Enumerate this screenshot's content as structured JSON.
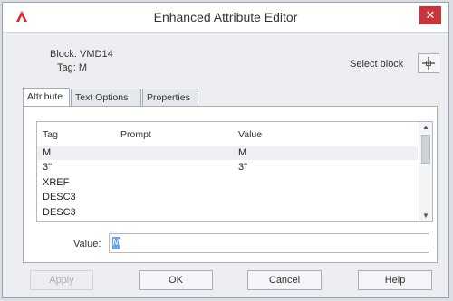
{
  "window": {
    "title": "Enhanced Attribute Editor",
    "close_glyph": "✕"
  },
  "block": {
    "block_line": "Block: VMD14",
    "tag_line": "Tag: M",
    "select_block_label": "Select block"
  },
  "tabs": [
    {
      "label": "Attribute",
      "active": true
    },
    {
      "label": "Text Options",
      "active": false
    },
    {
      "label": "Properties",
      "active": false
    }
  ],
  "table": {
    "headers": [
      "Tag",
      "Prompt",
      "Value"
    ],
    "rows": [
      {
        "tag": "M",
        "prompt": "",
        "value": "M",
        "selected": true
      },
      {
        "tag": "3\"",
        "prompt": "",
        "value": "3\"",
        "selected": false
      },
      {
        "tag": "XREF",
        "prompt": "",
        "value": "",
        "selected": false
      },
      {
        "tag": "DESC3",
        "prompt": "",
        "value": "",
        "selected": false
      },
      {
        "tag": "DESC3",
        "prompt": "",
        "value": "",
        "selected": false
      }
    ]
  },
  "value_field": {
    "label": "Value:",
    "current_value": "M"
  },
  "buttons": {
    "apply": "Apply",
    "ok": "OK",
    "cancel": "Cancel",
    "help": "Help"
  },
  "icons": {
    "app": "autocad-a-icon",
    "select_block": "crosshair-icon"
  },
  "colors": {
    "close_button": "#c8343a",
    "app_icon": "#d3272d",
    "selection": "#6da6e8"
  }
}
